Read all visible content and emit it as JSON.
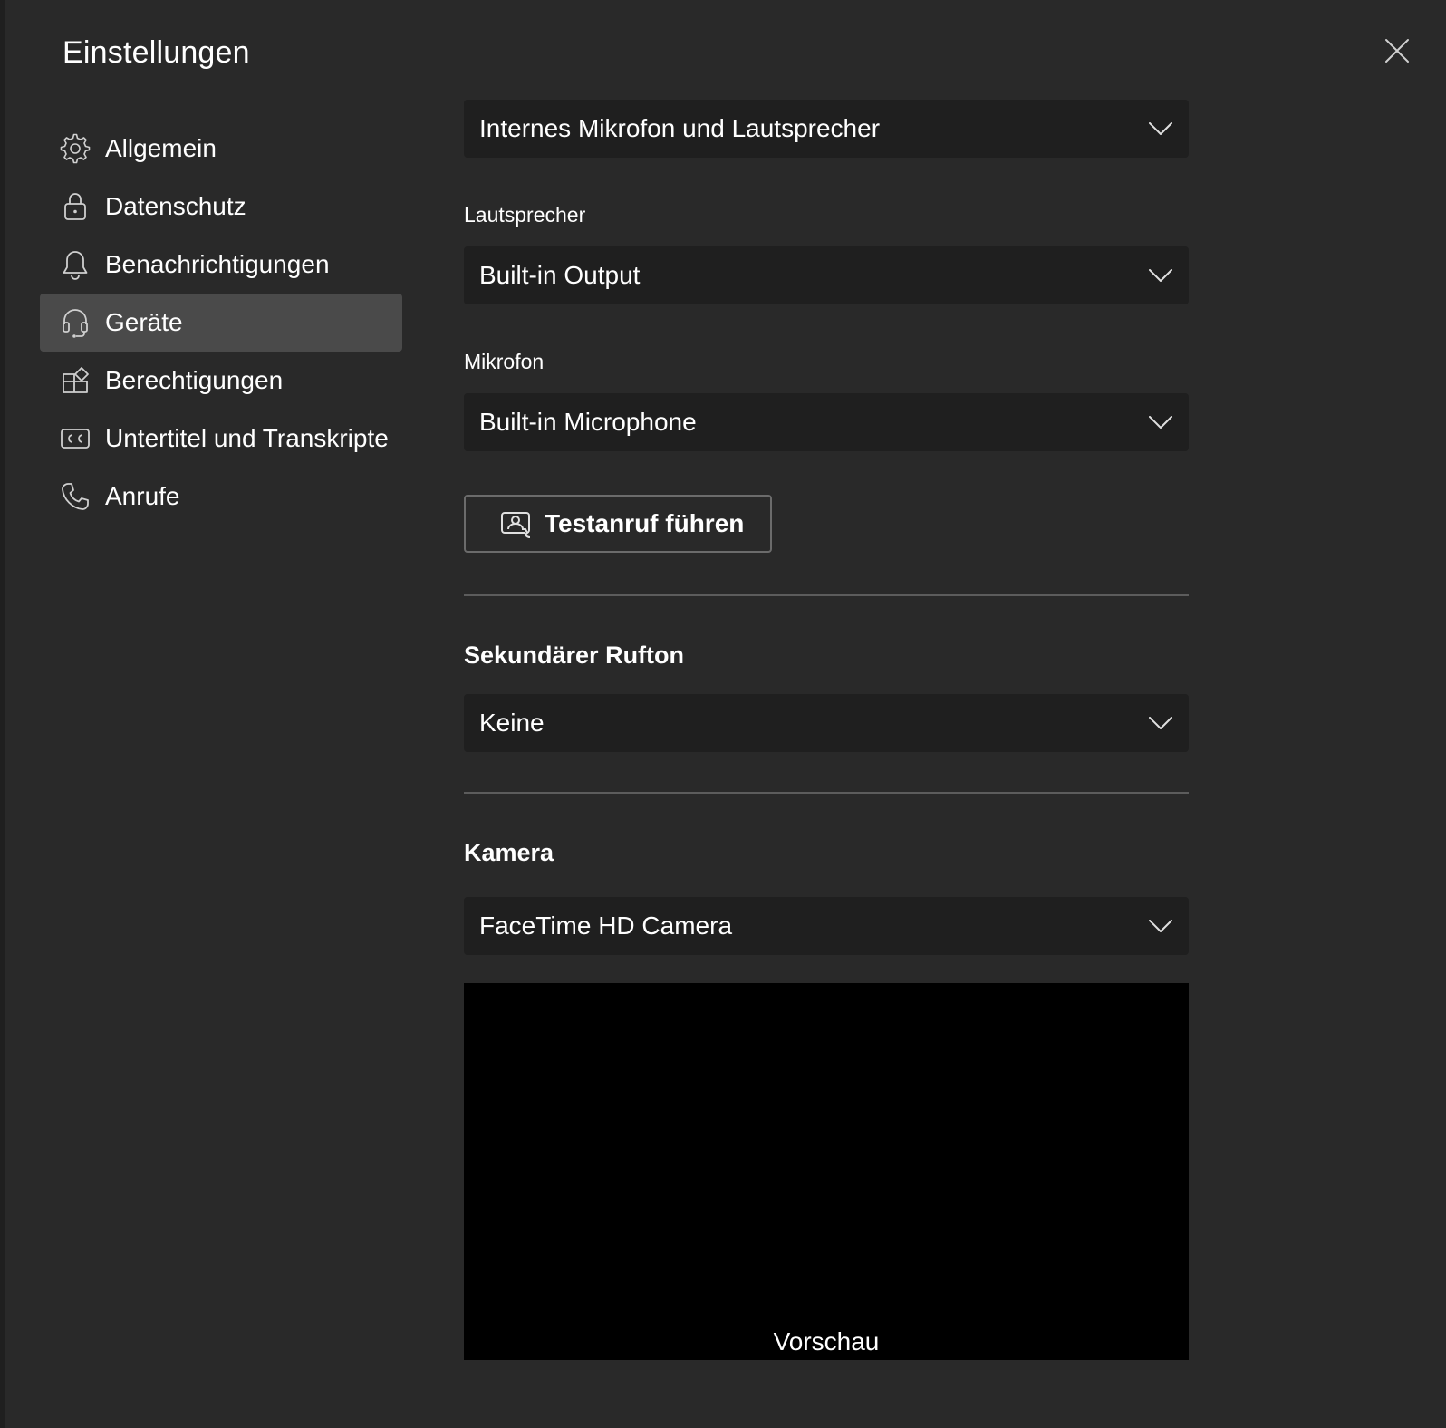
{
  "title": "Einstellungen",
  "close_icon": "close-icon",
  "sidebar": {
    "items": [
      {
        "label": "Allgemein",
        "icon": "gear-icon"
      },
      {
        "label": "Datenschutz",
        "icon": "lock-icon"
      },
      {
        "label": "Benachrichtigungen",
        "icon": "bell-icon"
      },
      {
        "label": "Geräte",
        "icon": "headset-icon",
        "active": true
      },
      {
        "label": "Berechtigungen",
        "icon": "apps-icon"
      },
      {
        "label": "Untertitel und Transkripte",
        "icon": "closed-captions-icon"
      },
      {
        "label": "Anrufe",
        "icon": "phone-icon"
      }
    ]
  },
  "devices": {
    "audio_device": "Internes Mikrofon und Lautsprecher",
    "speaker_label": "Lautsprecher",
    "speaker_value": "Built-in Output",
    "microphone_label": "Mikrofon",
    "microphone_value": "Built-in Microphone",
    "test_call_label": "Testanruf führen",
    "secondary_ringer_heading": "Sekundärer Rufton",
    "secondary_ringer_value": "Keine",
    "camera_heading": "Kamera",
    "camera_value": "FaceTime HD Camera",
    "preview_label": "Vorschau"
  },
  "colors": {
    "background": "#292929",
    "select_background": "#1f1f1f",
    "active_item": "#4a4a4a",
    "divider": "#5c5c5c",
    "text": "#ffffff"
  }
}
